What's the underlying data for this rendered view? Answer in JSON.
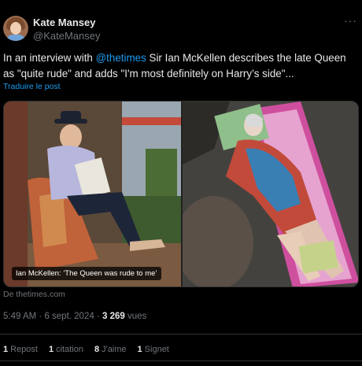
{
  "author": {
    "display_name": "Kate Mansey",
    "handle": "@KateMansey",
    "avatar_icon": "avatar-photo"
  },
  "more_icon": "more-horizontal-icon",
  "tweet": {
    "prefix": "In an interview with ",
    "mention": "@thetimes",
    "suffix": " Sir Ian McKellen describes the late Queen as \"quite rude\" and adds \"I'm most definitely on Harry’s side\"..."
  },
  "translate_label": "Traduire le post",
  "media": {
    "caption": "Ian McKellen: ‘The Queen was rude to me’",
    "source": "De thetimes.com"
  },
  "meta": {
    "time": "5:49 AM",
    "date": "6 sept. 2024",
    "views_count": "3 269",
    "views_label": "vues"
  },
  "stats": [
    {
      "count": "1",
      "label": "Repost"
    },
    {
      "count": "1",
      "label": "citation"
    },
    {
      "count": "8",
      "label": "J'aime"
    },
    {
      "count": "1",
      "label": "Signet"
    }
  ]
}
